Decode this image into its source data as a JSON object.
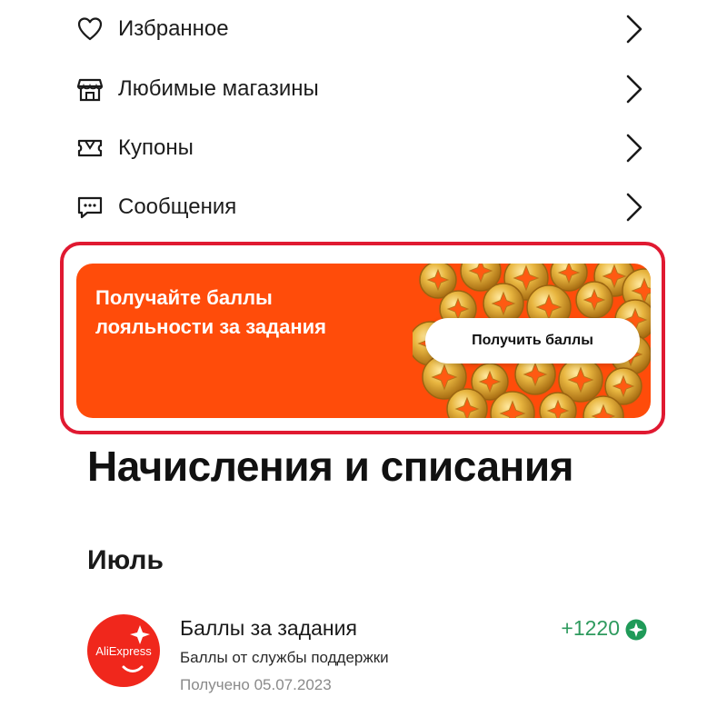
{
  "menu": {
    "items": [
      {
        "label": "Избранное",
        "icon": "heart-icon"
      },
      {
        "label": "Любимые магазины",
        "icon": "store-icon"
      },
      {
        "label": "Купоны",
        "icon": "coupon-icon"
      },
      {
        "label": "Сообщения",
        "icon": "message-icon"
      }
    ]
  },
  "promo": {
    "line1": "Получайте баллы",
    "line2": "лояльности за задания",
    "button_label": "Получить баллы",
    "background_color": "#ff4c0a",
    "highlight_color": "#e01931"
  },
  "history": {
    "title": "Начисления и списания",
    "month": "Июль",
    "transactions": [
      {
        "logo": "AliExpress",
        "title": "Баллы за задания",
        "subtitle": "Баллы от службы поддержки",
        "date": "Получено 05.07.2023",
        "amount": "+1220",
        "amount_color": "#2e9a5e",
        "badge_icon": "points-coin-icon"
      }
    ]
  }
}
